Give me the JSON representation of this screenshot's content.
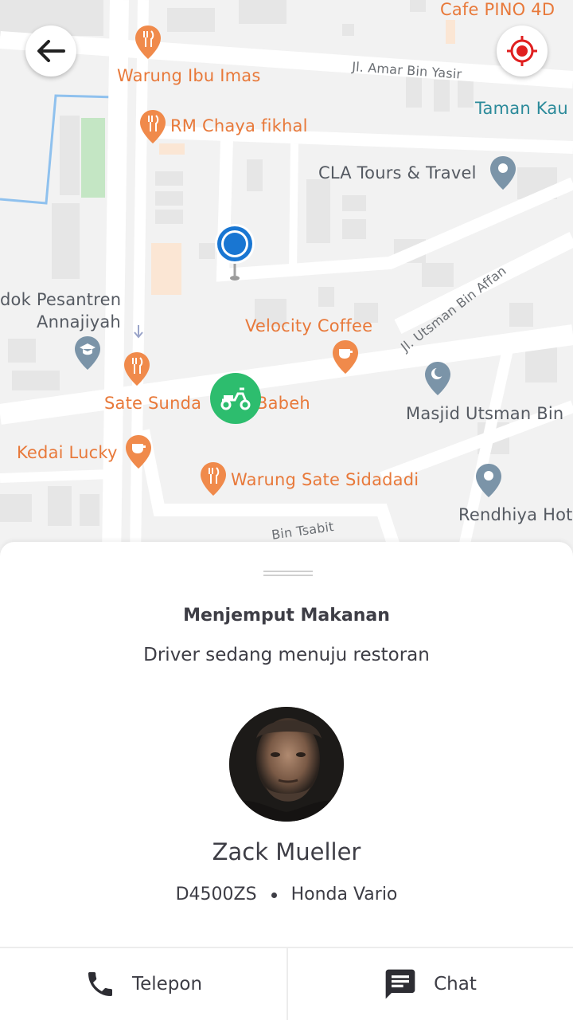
{
  "map": {
    "labels": {
      "cafe_pino": "Cafe PINO 4D",
      "warung_ibu_imas": "Warung Ibu Imas",
      "jl_amar_bin_yasir": "Jl. Amar Bin Yasir",
      "taman_kau": "Taman Kau",
      "rm_chaya_fikhal": "RM Chaya fikhal",
      "cla_tours": "CLA Tours & Travel",
      "pesantren": "dok Pesantren",
      "annajiyah": "Annajiyah",
      "velocity_coffee": "Velocity Coffee",
      "jl_utsman": "Jl. Utsman Bin Affan",
      "masjid_utsman": "Masjid Utsman Bin",
      "sate_sunda": "Sate Sunda",
      "babeh": "Babeh",
      "kedai_lucky": "Kedai Lucky",
      "warung_sate": "Warung Sate Sidadadi",
      "rendhiya": "Rendhiya Hot",
      "bin_tsabit": "Bin Tsabit"
    },
    "colors": {
      "background": "#f2f2f2",
      "road": "#ffffff",
      "orange_poi": "#e8793a",
      "teal_poi": "#2b8a9a",
      "user_location": "#1976d2",
      "driver_marker": "#2dbd6e",
      "target_icon": "#e02020"
    }
  },
  "controls": {
    "back_icon": "arrow-left-icon",
    "locate_icon": "crosshair-target-icon"
  },
  "status": {
    "title": "Menjemput Makanan",
    "subtitle": "Driver sedang menuju restoran"
  },
  "driver": {
    "name": "Zack Mueller",
    "plate": "D4500ZS",
    "vehicle": "Honda Vario"
  },
  "actions": {
    "call": {
      "label": "Telepon",
      "icon": "phone-icon"
    },
    "chat": {
      "label": "Chat",
      "icon": "chat-icon"
    }
  }
}
